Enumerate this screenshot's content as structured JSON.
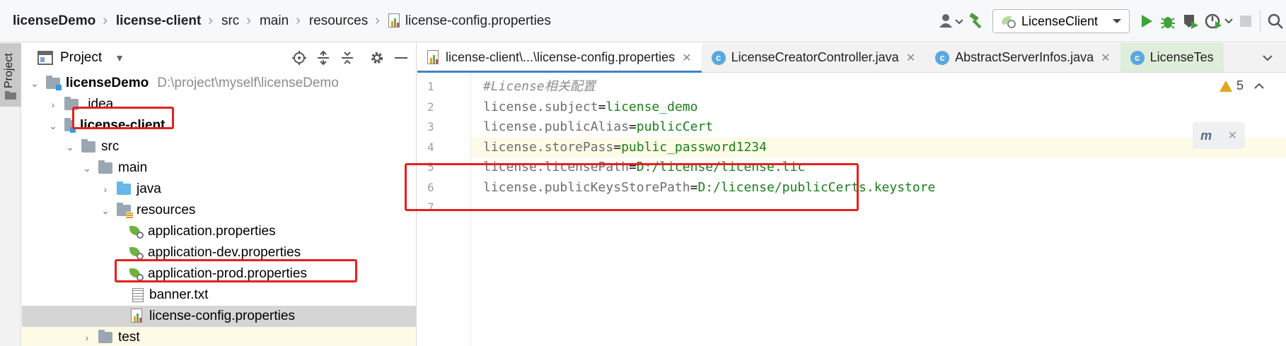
{
  "breadcrumb": {
    "items": [
      "licenseDemo",
      "license-client",
      "src",
      "main",
      "resources",
      "license-config.properties"
    ]
  },
  "toolbar": {
    "run_config_name": "LicenseClient",
    "icons": [
      "user-icon",
      "hammer-icon",
      "run-icon",
      "debug-icon",
      "coverage-icon",
      "profile-icon",
      "stop-icon",
      "search-icon"
    ]
  },
  "stripe": {
    "label": "Project"
  },
  "project_panel": {
    "title": "Project",
    "tree": [
      {
        "label": "licenseDemo",
        "path": "D:\\project\\myself\\licenseDemo"
      },
      {
        "label": ".idea"
      },
      {
        "label": "license-client"
      },
      {
        "label": "src"
      },
      {
        "label": "main"
      },
      {
        "label": "java"
      },
      {
        "label": "resources"
      },
      {
        "label": "application.properties"
      },
      {
        "label": "application-dev.properties"
      },
      {
        "label": "application-prod.properties"
      },
      {
        "label": "banner.txt"
      },
      {
        "label": "license-config.properties"
      },
      {
        "label": "test"
      }
    ]
  },
  "editor": {
    "tabs": [
      {
        "label": "license-client\\...\\license-config.properties"
      },
      {
        "label": "LicenseCreatorController.java"
      },
      {
        "label": "AbstractServerInfos.java"
      },
      {
        "label": "LicenseTes"
      }
    ],
    "warnings_count": "5",
    "line_numbers": [
      "1",
      "2",
      "3",
      "4",
      "5",
      "6",
      "7"
    ],
    "lines": [
      {
        "comment": "#License相关配置"
      },
      {
        "key": "license.subject",
        "value": "license_demo"
      },
      {
        "key": "license.publicAlias",
        "value": "publicCert"
      },
      {
        "key": "license.storePass",
        "value": "public_password1234"
      },
      {
        "key": "license.licensePath",
        "value": "D:/license/license.lic"
      },
      {
        "key": "license.publicKeysStorePath",
        "value": "D:/license/publicCerts.keystore"
      },
      {}
    ]
  },
  "colors": {
    "highlight_box": "#e6201c",
    "accent": "#4083c9",
    "string_value": "#1a7f1a"
  }
}
